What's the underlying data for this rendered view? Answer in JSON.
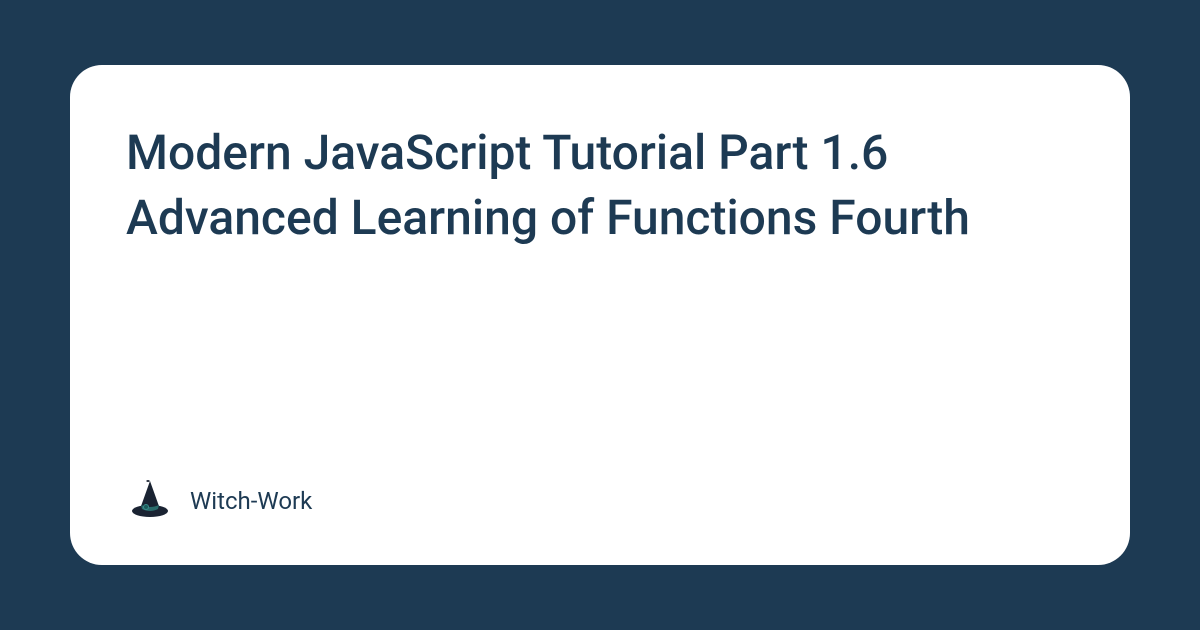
{
  "card": {
    "title": "Modern JavaScript Tutorial Part 1.6 Advanced Learning of Functions Fourth",
    "brand": "Witch-Work"
  },
  "colors": {
    "background": "#1d3a53",
    "card_bg": "#ffffff",
    "text": "#1d3a53"
  }
}
